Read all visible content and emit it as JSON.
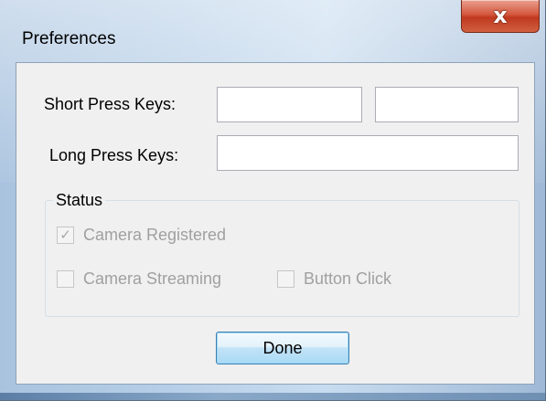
{
  "window": {
    "title": "Preferences",
    "close_glyph": "x"
  },
  "form": {
    "short_press_label": "Short Press Keys:",
    "short_press_value_1": "",
    "short_press_value_2": "",
    "long_press_label": "Long Press Keys:",
    "long_press_value": ""
  },
  "status": {
    "title": "Status",
    "checkboxes": [
      {
        "label": "Camera Registered",
        "checked": true,
        "enabled": false
      },
      {
        "label": "Camera Streaming",
        "checked": false,
        "enabled": false
      },
      {
        "label": "Button Click",
        "checked": false,
        "enabled": false
      }
    ]
  },
  "buttons": {
    "done_label": "Done"
  },
  "icons": {
    "close": "close-icon",
    "check": "check-icon"
  },
  "colors": {
    "close_button": "#c0391f",
    "client_background": "#f0f0f0",
    "disabled_text": "#a0a0a0",
    "default_button_border": "#3c7fb1"
  }
}
